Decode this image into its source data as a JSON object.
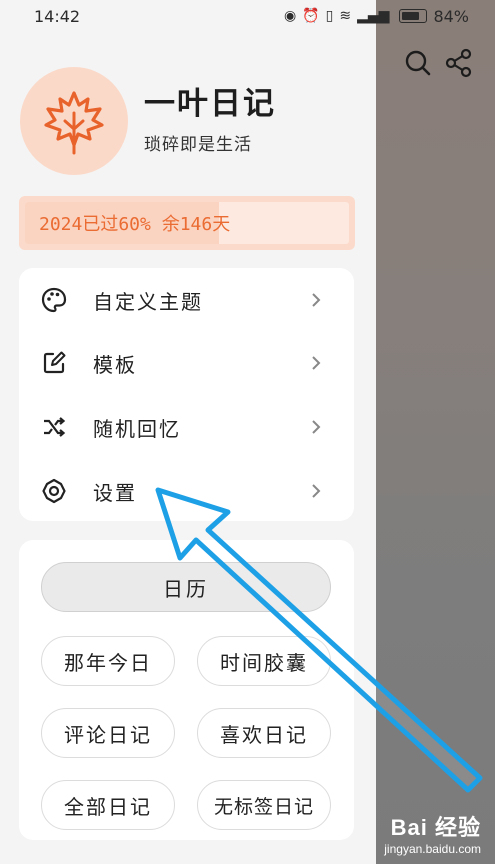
{
  "status_bar": {
    "time": "14:42",
    "battery_percent": "84%",
    "icons": [
      "eye-icon",
      "alarm-icon",
      "vibrate-icon",
      "wifi-icon",
      "signal-icon",
      "battery-icon"
    ]
  },
  "background_app": {
    "icons": [
      "search-icon",
      "share-icon"
    ]
  },
  "profile": {
    "title": "一叶日记",
    "subtitle": "琐碎即是生活",
    "avatar_icon": "maple-leaf-icon"
  },
  "year_progress": {
    "text": "2024已过60% 余146天",
    "fraction": 0.6
  },
  "menu": {
    "items": [
      {
        "label": "自定义主题",
        "icon": "palette-icon"
      },
      {
        "label": "模板",
        "icon": "edit-square-icon"
      },
      {
        "label": "随机回忆",
        "icon": "shuffle-icon"
      },
      {
        "label": "设置",
        "icon": "gear-icon"
      }
    ]
  },
  "shortcuts": {
    "calendar": "日历",
    "buttons": [
      "那年今日",
      "时间胶囊",
      "评论日记",
      "喜欢日记",
      "全部日记",
      "无标签日记"
    ]
  },
  "colors": {
    "accent": "#ea6c33",
    "avatar_bg": "#fbd9c9",
    "annotation_arrow": "#1ea0e6"
  },
  "watermark": {
    "main": "Bai 经验",
    "sub": "jingyan.baidu.com"
  }
}
